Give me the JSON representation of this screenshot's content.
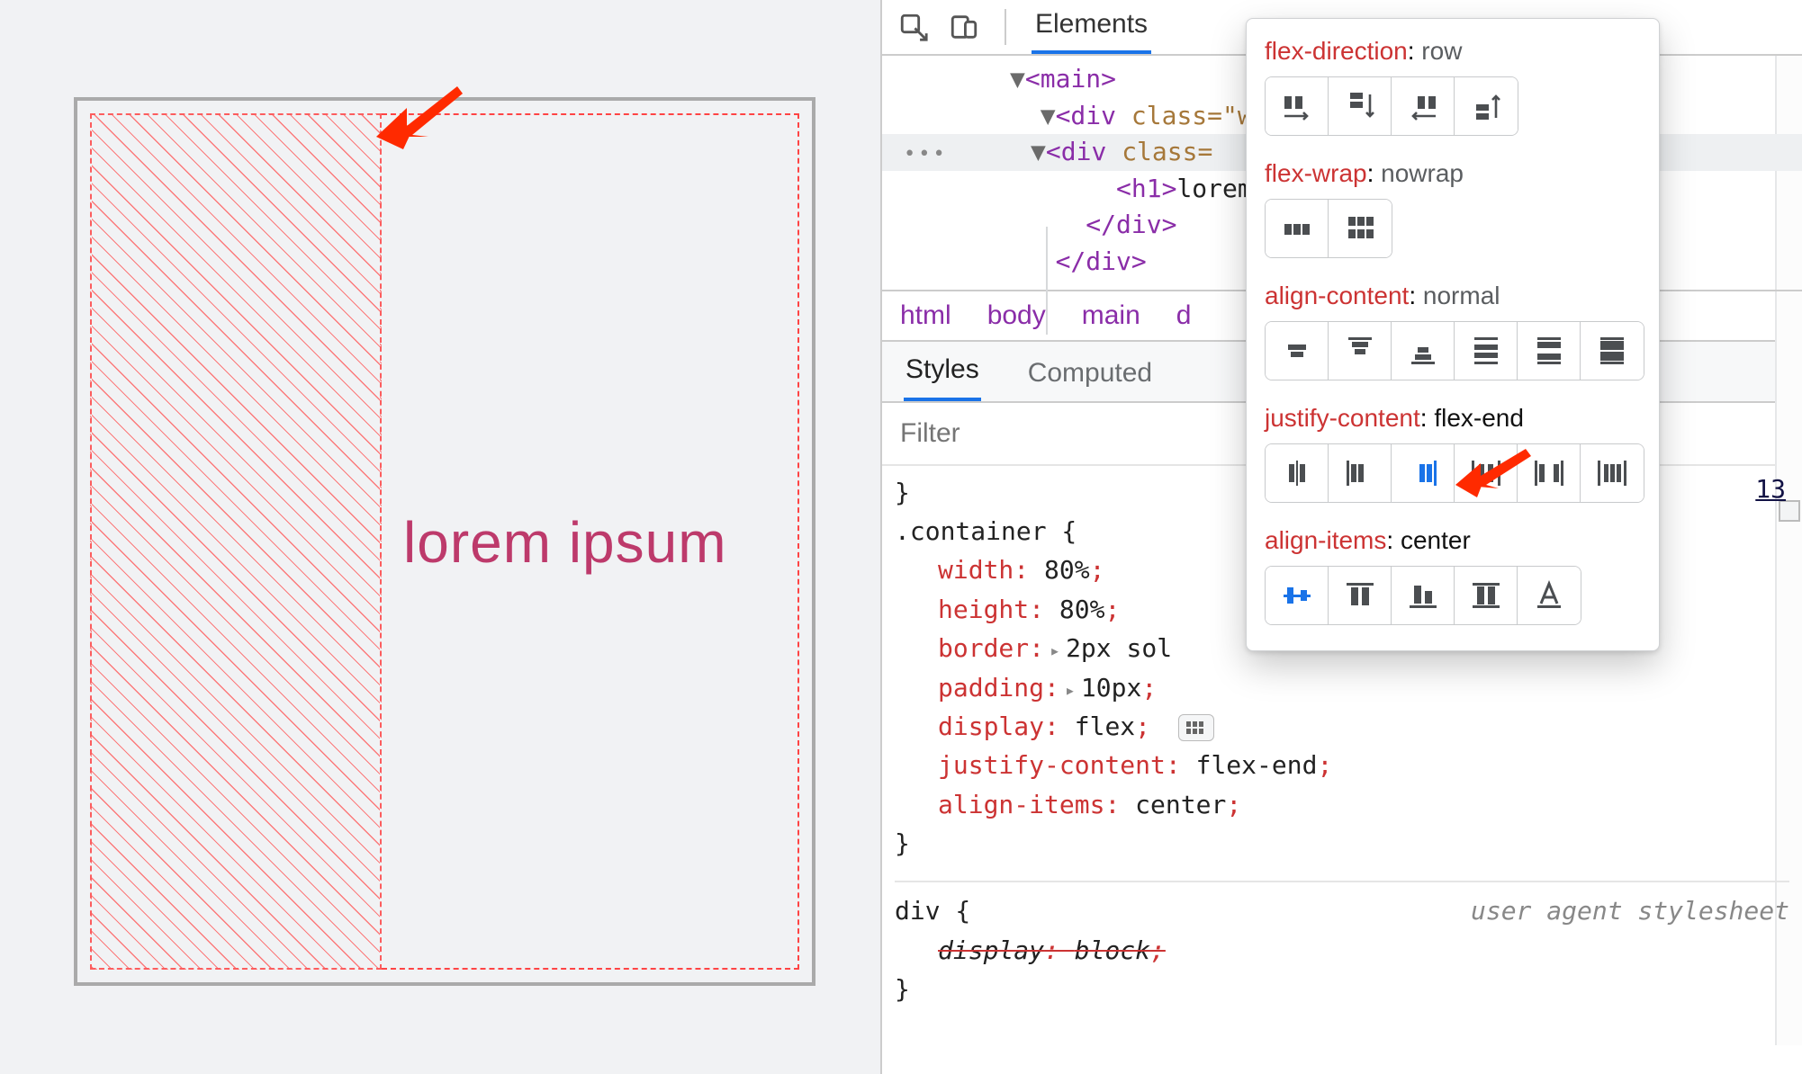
{
  "preview": {
    "heading": "lorem ipsum"
  },
  "toolbar": {
    "elements_tab": "Elements"
  },
  "dom": {
    "l1": "<main>",
    "l2_open": "<div ",
    "l2_attr": "class=\"w",
    "l3_open": "<div ",
    "l3_attr": "class=",
    "l4_open": "<h1>",
    "l4_text": "lorem",
    "l5": "</div>",
    "l6": "</div>"
  },
  "breadcrumb": {
    "b1": "html",
    "b2": "body",
    "b3": "main",
    "b4": "d"
  },
  "subtabs": {
    "styles": "Styles",
    "computed": "Computed"
  },
  "filter": {
    "placeholder": "Filter"
  },
  "rule": {
    "selector": ".container {",
    "p1n": "width",
    "p1v": "80%",
    "p2n": "height",
    "p2v": "80%",
    "p3n": "border",
    "p3v": "2px sol",
    "p4n": "padding",
    "p4v": "10px",
    "p5n": "display",
    "p5v": "flex",
    "p6n": "justify-content",
    "p6v": "flex-end",
    "p7n": "align-items",
    "p7v": "center",
    "close": "}"
  },
  "ua": {
    "selector": "div {",
    "p1n": "display",
    "p1v": "block",
    "close": "}",
    "label": "user agent stylesheet"
  },
  "line_ref": "13",
  "popover": {
    "fd_key": "flex-direction",
    "fd_val": "row",
    "fw_key": "flex-wrap",
    "fw_val": "nowrap",
    "ac_key": "align-content",
    "ac_val": "normal",
    "jc_key": "justify-content",
    "jc_val": "flex-end",
    "ai_key": "align-items",
    "ai_val": "center"
  }
}
